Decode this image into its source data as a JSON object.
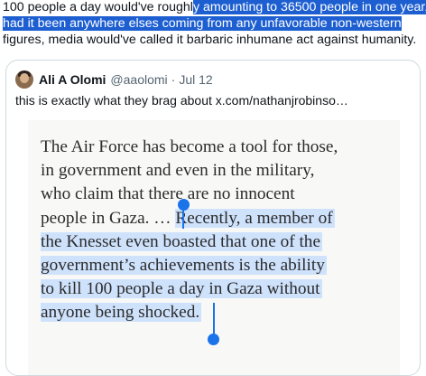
{
  "tweet": {
    "line1_plain": "100 people a day would've roughl",
    "line1_selected": "y amounting to 36500 people in one year,",
    "line2_selected": "had it been anywhere elses coming from any unfavorable non-western",
    "line3_plain": "figures, media would've called it barbaric inhumane act against humanity."
  },
  "quote": {
    "author_name": "Ali A Olomi",
    "author_handle": "@aaolomi",
    "separator": "·",
    "date": "Jul 12",
    "text": "this is exactly what they brag about  x.com/nathanjrobinso…"
  },
  "article": {
    "line1": "The Air Force has become a tool for those,",
    "line2": "in government and even in the military,",
    "line3": "who claim that there are no innocent",
    "line4_plain": "people in Gaza. … ",
    "line4_highlight": "Recently, a member of",
    "line5": "the Knesset even boasted that one of the",
    "line6": "government’s achievements is the ability",
    "line7": "to kill 100 people a day in Gaza without",
    "line8": "anyone being shocked."
  },
  "colors": {
    "selection": "#1d5fd1",
    "highlight": "#cfe2fc",
    "handle": "#1a73e8"
  }
}
